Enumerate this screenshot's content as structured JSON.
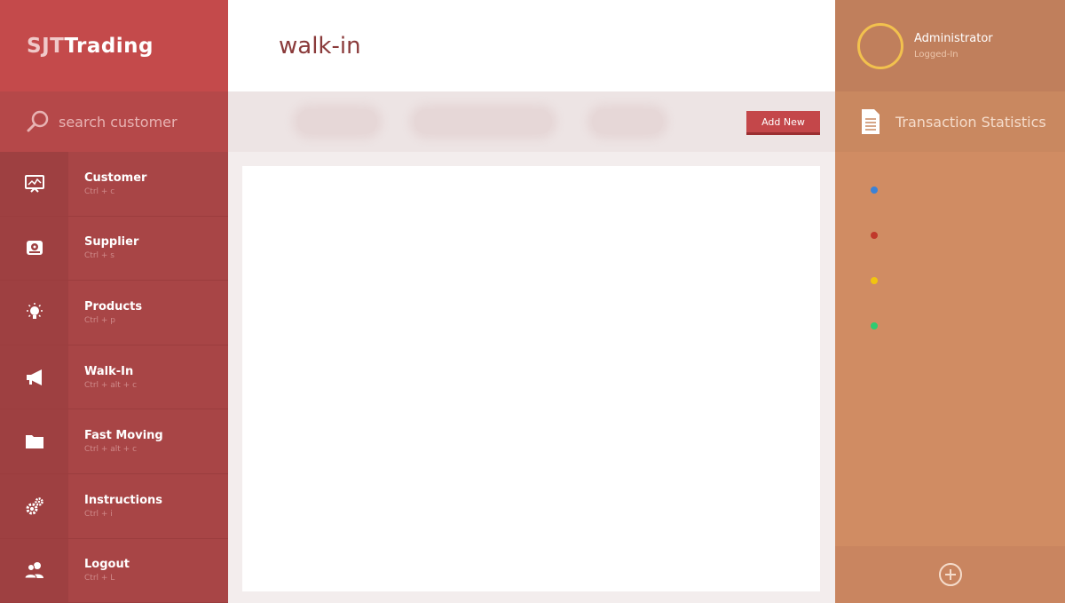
{
  "brand": {
    "part1": "SJT",
    "part2": "Trading"
  },
  "search": {
    "placeholder": "search customer"
  },
  "menu": [
    {
      "label": "Customer",
      "shortcut": "Ctrl + c",
      "icon": "presentation-icon"
    },
    {
      "label": "Supplier",
      "shortcut": "Ctrl + s",
      "icon": "drive-icon"
    },
    {
      "label": "Products",
      "shortcut": "Ctrl + p",
      "icon": "lightbulb-icon"
    },
    {
      "label": "Walk-In",
      "shortcut": "Ctrl + alt + c",
      "icon": "megaphone-icon"
    },
    {
      "label": "Fast Moving",
      "shortcut": "Ctrl + alt + c",
      "icon": "folder-icon"
    },
    {
      "label": "Instructions",
      "shortcut": "Ctrl + i",
      "icon": "gears-icon"
    },
    {
      "label": "Logout",
      "shortcut": "Ctrl + L",
      "icon": "users-icon"
    }
  ],
  "main": {
    "title": "walk-in",
    "add_button": "Add New"
  },
  "profile": {
    "name": "Administrator",
    "status": "Logged-In"
  },
  "stats": {
    "title": "Transaction Statistics",
    "dot_colors": [
      "#3b82d6",
      "#c0392b",
      "#f1c40f",
      "#2ecc71"
    ]
  },
  "colors": {
    "sidebar": "#a84444",
    "brand": "#c44a4b",
    "accent": "#c4474a",
    "right_panel": "#d08c63",
    "avatar_ring": "#f2c14e"
  }
}
